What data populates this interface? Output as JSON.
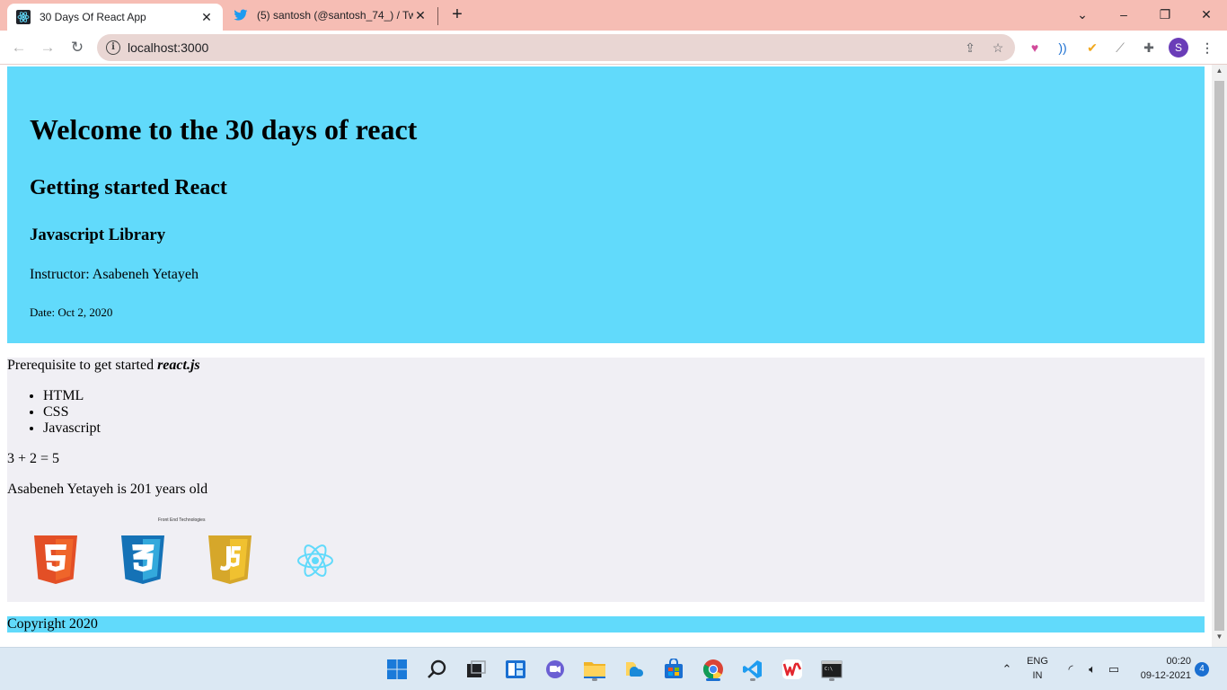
{
  "browser": {
    "tabs": [
      {
        "title": "30 Days Of React App",
        "active": true
      },
      {
        "title": "(5) santosh (@santosh_74_) / Twi",
        "active": false
      }
    ],
    "url": "localhost:3000",
    "profile_initial": "S",
    "window_controls": {
      "dropdown": "⌄",
      "minimize": "–",
      "restore": "❐",
      "close": "✕"
    },
    "nav": {
      "back": "←",
      "forward": "→",
      "reload": "↻"
    },
    "new_tab": "+",
    "tab_close": "✕"
  },
  "page": {
    "header": {
      "title": "Welcome to the 30 days of react",
      "subtitle": "Getting started React",
      "library": "Javascript Library",
      "instructor": "Instructor: Asabeneh Yetayeh",
      "date": "Date: Oct 2, 2020"
    },
    "main": {
      "prereq_text": "Prerequisite to get started ",
      "prereq_bold": "react.js",
      "techs": [
        "HTML",
        "CSS",
        "Javascript"
      ],
      "sum": "3 + 2 = 5",
      "age_text": "Asabeneh Yetayeh is 201 years old",
      "tech_caption": "Front End Technologies",
      "logos": [
        "html5-logo",
        "css3-logo",
        "javascript-logo",
        "react-logo"
      ]
    },
    "footer": {
      "copyright": "Copyright 2020"
    },
    "colors": {
      "header_bg": "#61dafb",
      "main_bg": "#f0eff4",
      "footer_bg": "#61dafb"
    }
  },
  "taskbar": {
    "language": "ENG",
    "region": "IN",
    "time": "00:20",
    "date": "09-12-2021",
    "notifications": "4",
    "apps": [
      "start-icon",
      "search-icon",
      "task-view-icon",
      "widgets-icon",
      "chat-icon",
      "file-explorer-icon",
      "onedrive-icon",
      "store-icon",
      "chrome-icon",
      "vscode-icon",
      "wps-office-icon",
      "terminal-icon"
    ]
  }
}
